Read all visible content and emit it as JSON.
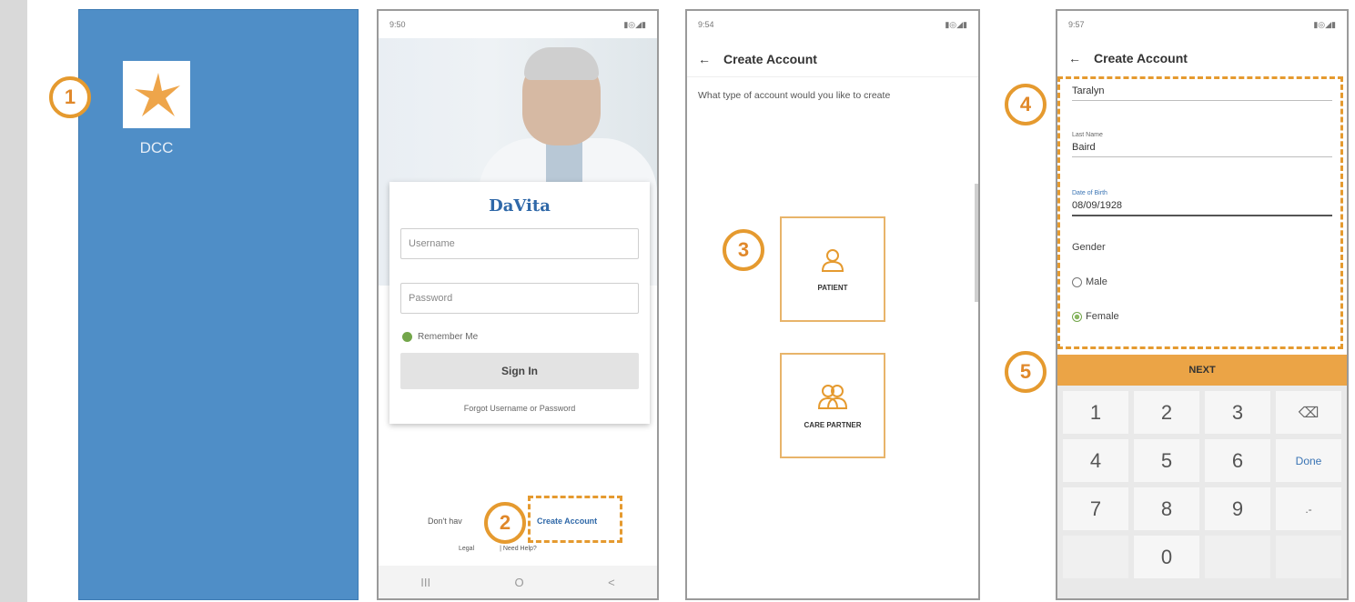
{
  "panel1": {
    "app_label": "DCC",
    "step": "1"
  },
  "panel2": {
    "status_time": "9:50",
    "status_right": "▮◎◢▮",
    "logo": "DaVita",
    "username_placeholder": "Username",
    "password_placeholder": "Password",
    "remember_me": "Remember Me",
    "sign_in": "Sign In",
    "forgot": "Forgot Username or Password",
    "dont_have": "Don't hav",
    "create_account": "Create Account",
    "legal": "Legal",
    "need_help": "| Need Help?",
    "step": "2",
    "nav": [
      "III",
      "O",
      "<"
    ]
  },
  "panel3": {
    "status_time": "9:54",
    "status_right": "▮◎◢▮",
    "back": "←",
    "title": "Create Account",
    "prompt": "What type of account would you like to create",
    "patient": "PATIENT",
    "care_partner": "CARE PARTNER",
    "step": "3"
  },
  "panel4": {
    "status_time": "9:57",
    "status_right": "▮◎◢▮",
    "back": "←",
    "title": "Create Account",
    "first_name": "Taralyn",
    "last_name_label": "Last Name",
    "last_name": "Baird",
    "dob_label": "Date of Birth",
    "dob": "08/09/1928",
    "gender_label": "Gender",
    "male": "Male",
    "female": "Female",
    "next": "NEXT",
    "step4": "4",
    "step5": "5",
    "keys": [
      "1",
      "2",
      "3",
      "⌫",
      "4",
      "5",
      "6",
      "Done",
      "7",
      "8",
      "9",
      ".-",
      "",
      "0",
      "",
      ""
    ]
  }
}
